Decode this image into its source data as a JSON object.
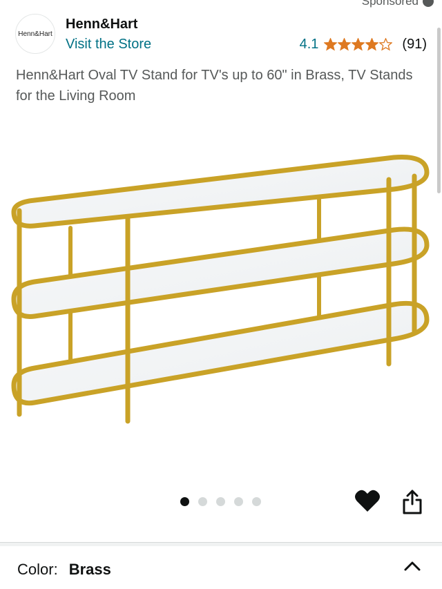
{
  "sponsored_label": "Sponsored",
  "brand": {
    "logo_text": "Henn&Hart",
    "name": "Henn&Hart",
    "visit_store": "Visit the Store"
  },
  "rating": {
    "value": "4.1",
    "stars": 4.1,
    "count": "(91)"
  },
  "title": "Henn&Hart Oval TV Stand for TV's up to 60\" in Brass, TV Stands for the Living Room",
  "carousel": {
    "image_count": 5,
    "active_index": 0
  },
  "variation": {
    "label": "Color:",
    "value": "Brass"
  },
  "colors": {
    "link": "#007185",
    "star": "#de7921",
    "brass": "#c9a227"
  },
  "icons": [
    "info-icon",
    "star-icon",
    "heart-icon",
    "share-icon",
    "chevron-up-icon"
  ]
}
